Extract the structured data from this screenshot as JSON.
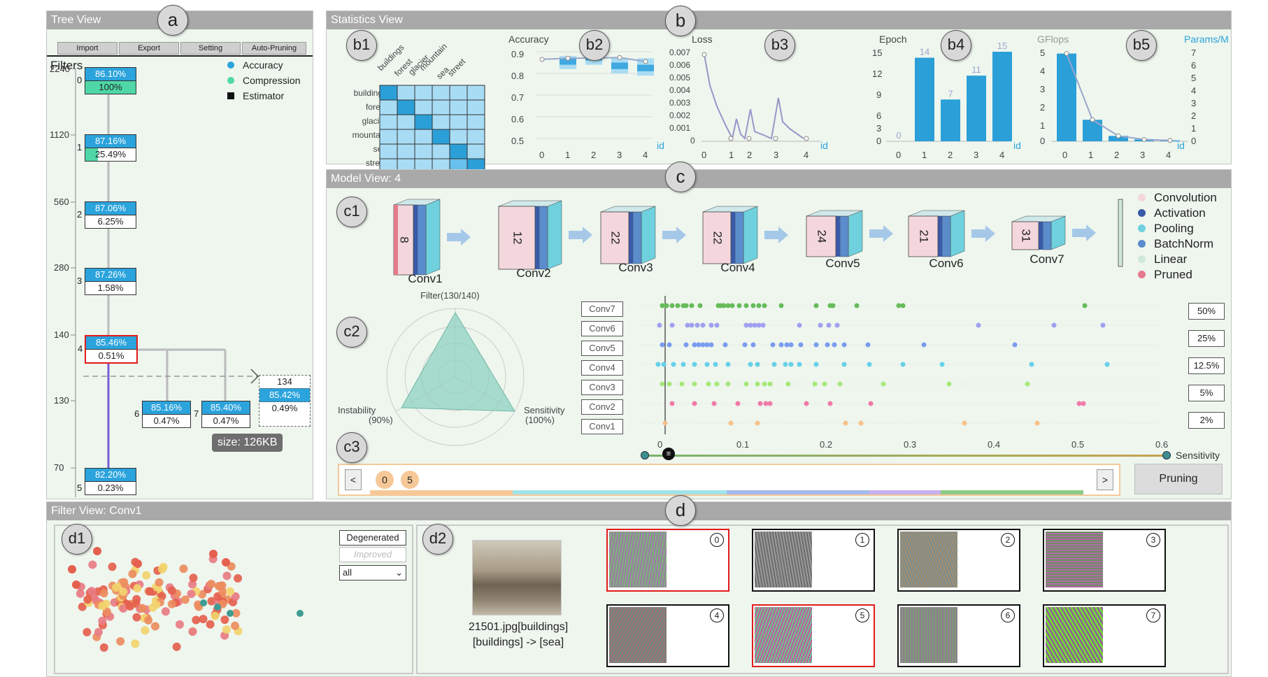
{
  "tree_view": {
    "title": "Tree View",
    "buttons": [
      "Import",
      "Export",
      "Setting",
      "Auto-Pruning"
    ],
    "filters_label": "Filters",
    "legend": [
      {
        "label": "Accuracy",
        "color": "#2ba3dc"
      },
      {
        "label": "Compression",
        "color": "#4fd7a8"
      },
      {
        "label": "Estimator",
        "color": "#111111"
      }
    ],
    "y_ticks": [
      "2240",
      "1120",
      "560",
      "280",
      "140",
      "130",
      "70"
    ],
    "nodes": [
      {
        "id": "0",
        "accuracy": "86.10%",
        "compression": "100%"
      },
      {
        "id": "1",
        "accuracy": "87.16%",
        "compression": "25.49%"
      },
      {
        "id": "2",
        "accuracy": "87.06%",
        "compression": "6.25%"
      },
      {
        "id": "3",
        "accuracy": "87.26%",
        "compression": "1.58%"
      },
      {
        "id": "4",
        "accuracy": "85.46%",
        "compression": "0.51%"
      },
      {
        "id": "5",
        "accuracy": "82.20%",
        "compression": "0.23%"
      },
      {
        "id": "6",
        "accuracy": "85.16%",
        "compression": "0.47%"
      },
      {
        "id": "7",
        "accuracy": "85.40%",
        "compression": "0.47%"
      }
    ],
    "estimator": {
      "value": "134",
      "accuracy": "85.42%",
      "compression": "0.49%"
    },
    "tooltip": "size: 126KB"
  },
  "statistics_view": {
    "title": "Statistics View",
    "confusion": {
      "classes": [
        "buildings",
        "forest",
        "glacier",
        "mountain",
        "sea",
        "street"
      ],
      "matrix": [
        [
          3,
          1,
          1,
          1,
          1,
          1
        ],
        [
          1,
          3,
          1,
          1,
          1,
          1
        ],
        [
          1,
          1,
          3,
          1,
          1,
          1
        ],
        [
          1,
          1,
          1,
          3,
          1,
          1
        ],
        [
          1,
          1,
          1,
          1,
          3,
          1
        ],
        [
          1,
          1,
          1,
          1,
          2,
          3
        ]
      ]
    },
    "accuracy": {
      "label": "Accuracy",
      "ticks": [
        "0.9",
        "0.8",
        "0.7",
        "0.6",
        "0.5"
      ],
      "x": [
        "0",
        "1",
        "2",
        "3",
        "4"
      ],
      "id": "id",
      "values": [
        0.865,
        0.87,
        0.871,
        0.873,
        0.855
      ]
    },
    "loss": {
      "label": "Loss",
      "ticks": [
        "0.007",
        "0.006",
        "0.005",
        "0.004",
        "0.003",
        "0.002",
        "0.001",
        "0"
      ],
      "x": [
        "0",
        "1",
        "2",
        "3",
        "4"
      ],
      "id": "id"
    },
    "epoch": {
      "label": "Epoch",
      "ticks": [
        "15",
        "12",
        "9",
        "6",
        "3",
        "0"
      ],
      "x": [
        "0",
        "1",
        "2",
        "3",
        "4"
      ],
      "id": "id",
      "values": [
        0,
        14,
        7,
        11,
        15
      ],
      "value_labels": [
        "0",
        "14",
        "7",
        "11",
        "15"
      ]
    },
    "gflops": {
      "label_left": "GFlops",
      "label_right": "Params/M",
      "ticks_left": [
        "5",
        "4",
        "3",
        "2",
        "1",
        "0"
      ],
      "ticks_right": [
        "7",
        "6",
        "5",
        "4",
        "3",
        "2",
        "1",
        "0"
      ],
      "x": [
        "0",
        "1",
        "2",
        "3",
        "4"
      ],
      "id": "id",
      "values": [
        4.9,
        1.2,
        0.3,
        0.1,
        0.05
      ]
    }
  },
  "model_view": {
    "title": "Model View: 4",
    "layers": [
      {
        "name": "Conv1",
        "filters": "8"
      },
      {
        "name": "Conv2",
        "filters": "12"
      },
      {
        "name": "Conv3",
        "filters": "22"
      },
      {
        "name": "Conv4",
        "filters": "22"
      },
      {
        "name": "Conv5",
        "filters": "24"
      },
      {
        "name": "Conv6",
        "filters": "21"
      },
      {
        "name": "Conv7",
        "filters": "31"
      }
    ],
    "legend": [
      {
        "label": "Convolution",
        "color": "#f4d7dc"
      },
      {
        "label": "Activation",
        "color": "#3a5ba8"
      },
      {
        "label": "Pooling",
        "color": "#6fd1dd"
      },
      {
        "label": "BatchNorm",
        "color": "#5b8ccc"
      },
      {
        "label": "Linear",
        "color": "#cfe8d9"
      },
      {
        "label": "Pruned",
        "color": "#e57a8c"
      }
    ],
    "radar": {
      "top": "Filter(130/140)",
      "left": "Instability",
      "left_pct": "(90%)",
      "right": "Sensitivity",
      "right_pct": "(100%)"
    },
    "conv_labels": [
      "Conv7",
      "Conv6",
      "Conv5",
      "Conv4",
      "Conv3",
      "Conv2",
      "Conv1"
    ],
    "percent_buttons": [
      "50%",
      "25%",
      "12.5%",
      "5%",
      "2%"
    ],
    "sens_ticks": [
      "0",
      "0.1",
      "0.2",
      "0.3",
      "0.4",
      "0.5",
      "0.6"
    ],
    "sens_label": "Sensitivity",
    "slider_value": 0.005,
    "history": [
      "0",
      "5"
    ],
    "prev": "<",
    "next": ">",
    "prune_button": "Pruning"
  },
  "filter_view": {
    "title": "Filter View: Conv1",
    "dropdown_top": "Degenerated",
    "dropdown_mid": "Improved",
    "select_value": "all",
    "image_caption": "21501.jpg[buildings]",
    "image_pred": "[buildings] -> [sea]",
    "filters": [
      "0",
      "1",
      "2",
      "3",
      "4",
      "5",
      "6",
      "7"
    ]
  },
  "callouts": {
    "a": "a",
    "b": "b",
    "b1": "b1",
    "b2": "b2",
    "b3": "b3",
    "b4": "b4",
    "b5": "b5",
    "c": "c",
    "c1": "c1",
    "c2": "c2",
    "c3": "c3",
    "d": "d",
    "d1": "d1",
    "d2": "d2"
  },
  "colors": {
    "accuracy": "#2ba3dc",
    "compression": "#4fd7a8",
    "selected": "#e21b1b"
  }
}
